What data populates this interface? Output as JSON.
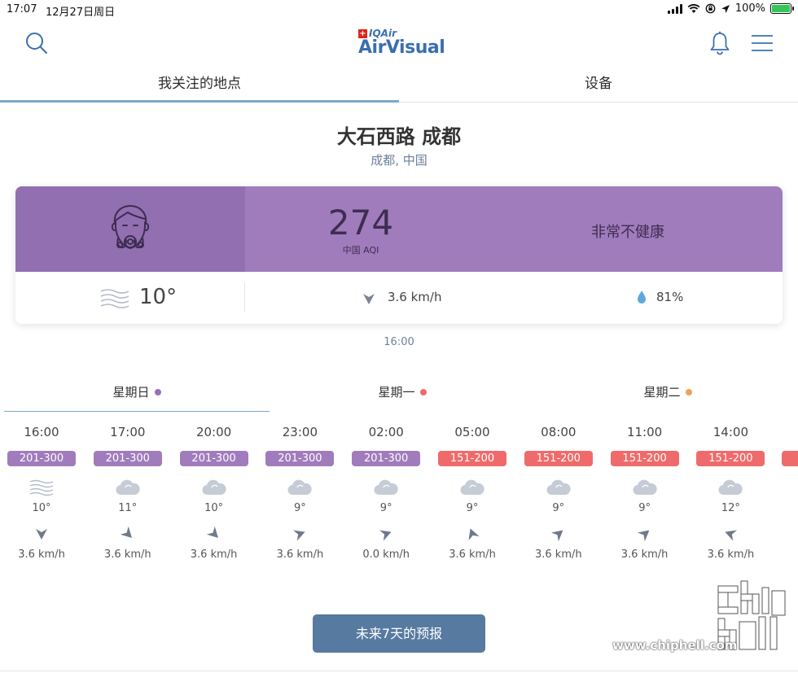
{
  "status_bar": {
    "time": "17:07",
    "date": "12月27日周日",
    "battery": "100%"
  },
  "header": {
    "logo_small": "IQAir",
    "logo_big": "AirVisual"
  },
  "tabs": [
    {
      "label": "我关注的地点"
    },
    {
      "label": "设备"
    }
  ],
  "location": {
    "name": "大石西路 成都",
    "region": "成都, 中国"
  },
  "aqi": {
    "value": "274",
    "label": "中国 AQI",
    "status": "非常不健康",
    "colors": {
      "band": "#a07cbc",
      "face_box": "#926fb0"
    }
  },
  "weather": {
    "temperature": "10°",
    "wind": "3.6 km/h",
    "humidity": "81%"
  },
  "update_time": "16:00",
  "days": [
    {
      "label": "星期日",
      "dot_color": "#9b6fbd"
    },
    {
      "label": "星期一",
      "dot_color": "#ef6b6b"
    },
    {
      "label": "星期二",
      "dot_color": "#f2a05a"
    }
  ],
  "hourly": [
    {
      "time": "16:00",
      "aqi_range": "201-300",
      "badge_color": "#a07cbc",
      "icon": "haze-icon",
      "temp": "10°",
      "wind_dir_deg": 0,
      "wind": "3.6 km/h"
    },
    {
      "time": "17:00",
      "aqi_range": "201-300",
      "badge_color": "#a07cbc",
      "icon": "cloud-icon",
      "temp": "11°",
      "wind_dir_deg": -45,
      "wind": "3.6 km/h"
    },
    {
      "time": "20:00",
      "aqi_range": "201-300",
      "badge_color": "#a07cbc",
      "icon": "cloud-icon",
      "temp": "10°",
      "wind_dir_deg": -45,
      "wind": "3.6 km/h"
    },
    {
      "time": "23:00",
      "aqi_range": "201-300",
      "badge_color": "#a07cbc",
      "icon": "cloud-icon",
      "temp": "9°",
      "wind_dir_deg": -110,
      "wind": "3.6 km/h"
    },
    {
      "time": "02:00",
      "aqi_range": "201-300",
      "badge_color": "#a07cbc",
      "icon": "cloud-icon",
      "temp": "9°",
      "wind_dir_deg": -110,
      "wind": "0.0 km/h"
    },
    {
      "time": "05:00",
      "aqi_range": "151-200",
      "badge_color": "#ef6b6b",
      "icon": "cloud-icon",
      "temp": "9°",
      "wind_dir_deg": 160,
      "wind": "3.6 km/h"
    },
    {
      "time": "08:00",
      "aqi_range": "151-200",
      "badge_color": "#ef6b6b",
      "icon": "cloud-icon",
      "temp": "9°",
      "wind_dir_deg": -130,
      "wind": "3.6 km/h"
    },
    {
      "time": "11:00",
      "aqi_range": "151-200",
      "badge_color": "#ef6b6b",
      "icon": "cloud-icon",
      "temp": "9°",
      "wind_dir_deg": -130,
      "wind": "3.6 km/h"
    },
    {
      "time": "14:00",
      "aqi_range": "151-200",
      "badge_color": "#ef6b6b",
      "icon": "cloud-icon",
      "temp": "12°",
      "wind_dir_deg": 110,
      "wind": "3.6 km/h"
    }
  ],
  "forecast_button": "未来7天的预报",
  "watermark": {
    "url": "www.chiphell.com",
    "logo_text": "chip hell"
  }
}
